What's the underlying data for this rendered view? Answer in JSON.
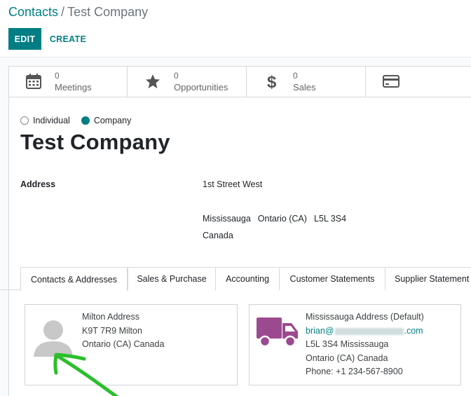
{
  "breadcrumb": {
    "parent": "Contacts",
    "separator": "/",
    "current": "Test Company"
  },
  "actions": {
    "edit_label": "EDIT",
    "create_label": "CREATE"
  },
  "stat_buttons": [
    {
      "icon": "calendar-icon",
      "value": "0",
      "label": "Meetings"
    },
    {
      "icon": "star-icon",
      "value": "0",
      "label": "Opportunities"
    },
    {
      "icon": "dollar-icon",
      "value": "0",
      "label": "Sales"
    },
    {
      "icon": "credit-card-icon",
      "value": "",
      "label": ""
    }
  ],
  "company_type": {
    "options": [
      "Individual",
      "Company"
    ],
    "selected": "Company"
  },
  "partner": {
    "name": "Test Company",
    "address_label": "Address",
    "street": "1st Street West",
    "city": "Mississauga",
    "state": "Ontario (CA)",
    "zip": "L5L 3S4",
    "country": "Canada"
  },
  "tabs": [
    {
      "label": "Contacts & Addresses",
      "active": true
    },
    {
      "label": "Sales & Purchase",
      "active": false
    },
    {
      "label": "Accounting",
      "active": false
    },
    {
      "label": "Customer Statements",
      "active": false
    },
    {
      "label": "Supplier Statement",
      "active": false
    }
  ],
  "contacts": [
    {
      "icon": "person-placeholder-icon",
      "name": "Milton Address",
      "line2": "K9T 7R9 Milton",
      "line3": "Ontario (CA) Canada"
    },
    {
      "icon": "truck-icon",
      "name": "Mississauga Address (Default)",
      "email_prefix": "brian@",
      "email_suffix": ".com",
      "line3": "L5L 3S4 Mississauga",
      "line4": "Ontario (CA) Canada",
      "phone": "Phone: +1 234-567-8900"
    }
  ],
  "colors": {
    "primary": "#017e84",
    "truck": "#9c4a8f",
    "annotation": "#2bbf2b"
  }
}
